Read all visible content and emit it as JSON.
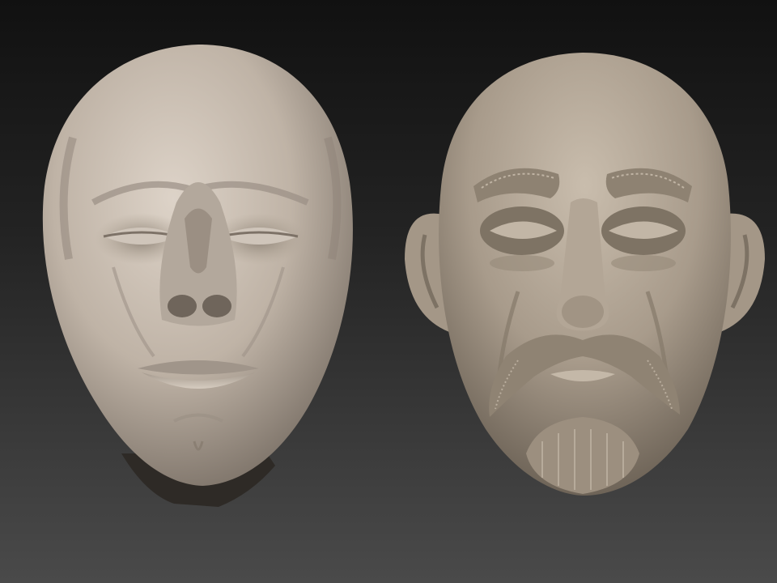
{
  "scene": {
    "background_top": "#111111",
    "background_bottom": "#4a4a4a",
    "models": [
      {
        "name": "sculpt-head-left",
        "skin": "#c9beb2"
      },
      {
        "name": "sculpt-head-right",
        "skin": "#b5a999"
      }
    ]
  }
}
